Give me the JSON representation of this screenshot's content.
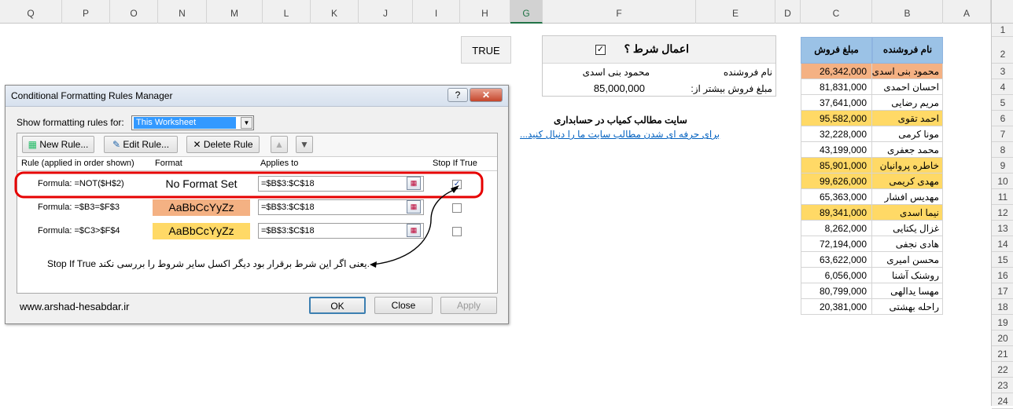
{
  "column_headers": [
    "Q",
    "P",
    "O",
    "N",
    "M",
    "L",
    "K",
    "J",
    "I",
    "H",
    "G",
    "F",
    "E",
    "D",
    "C",
    "B",
    "A"
  ],
  "selected_column": "G",
  "row_headers": [
    "1",
    "2",
    "3",
    "4",
    "5",
    "6",
    "7",
    "8",
    "9",
    "10",
    "11",
    "12",
    "13",
    "14",
    "15",
    "16",
    "17",
    "18",
    "19",
    "20",
    "21",
    "22",
    "23",
    "24"
  ],
  "true_cell": "TRUE",
  "condition_panel": {
    "title": "اعمال شرط ؟",
    "checkbox_checked": true,
    "row1_label": "نام فروشنده",
    "row1_value": "محمود بنی اسدی",
    "row2_label": "مبلغ فروش بیشتر از:",
    "row2_value": "85,000,000"
  },
  "site_note": {
    "title": "سایت مطالب کمیاب در حسابداری",
    "link": "برای حرفه ای شدن مطالب سایت ما را دنبال کنید..."
  },
  "table": {
    "header_seller": "نام فروشنده",
    "header_amount": "مبلغ فروش",
    "colors": {
      "header": "#9bc2e6",
      "row_match": "#f4b183",
      "amount_match": "#ffd966"
    },
    "rows": [
      {
        "name": "محمود بنی اسدی",
        "amount": "26,342,000",
        "highlight": "salmon"
      },
      {
        "name": "احسان احمدی",
        "amount": "81,831,000",
        "highlight": "none"
      },
      {
        "name": "مریم رضایی",
        "amount": "37,641,000",
        "highlight": "none"
      },
      {
        "name": "احمد تقوی",
        "amount": "95,582,000",
        "highlight": "yellow"
      },
      {
        "name": "مونا کرمی",
        "amount": "32,228,000",
        "highlight": "none"
      },
      {
        "name": "محمد جعفری",
        "amount": "43,199,000",
        "highlight": "none"
      },
      {
        "name": "خاطره پروانیان",
        "amount": "85,901,000",
        "highlight": "yellow"
      },
      {
        "name": "مهدی کریمی",
        "amount": "99,626,000",
        "highlight": "yellow"
      },
      {
        "name": "مهدیس افشار",
        "amount": "65,363,000",
        "highlight": "none"
      },
      {
        "name": "نیما اسدی",
        "amount": "89,341,000",
        "highlight": "yellow"
      },
      {
        "name": "غزال یکتایی",
        "amount": "8,262,000",
        "highlight": "none"
      },
      {
        "name": "هادی نجفی",
        "amount": "72,194,000",
        "highlight": "none"
      },
      {
        "name": "محسن امیری",
        "amount": "63,622,000",
        "highlight": "none"
      },
      {
        "name": "روشنک آشنا",
        "amount": "6,056,000",
        "highlight": "none"
      },
      {
        "name": "مهسا یدالهی",
        "amount": "80,799,000",
        "highlight": "none"
      },
      {
        "name": "راحله بهشتی",
        "amount": "20,381,000",
        "highlight": "none"
      }
    ]
  },
  "dialog": {
    "title": "Conditional Formatting Rules Manager",
    "help_label": "?",
    "show_label": "Show formatting rules for:",
    "show_value": "This Worksheet",
    "new_rule": "New Rule...",
    "edit_rule": "Edit Rule...",
    "delete_rule": "Delete Rule",
    "col_rule": "Rule (applied in order shown)",
    "col_format": "Format",
    "col_applies": "Applies to",
    "col_stop": "Stop If True",
    "rules": [
      {
        "formula": "Formula: =NOT($H$2)",
        "format": "No Format Set",
        "format_bg": "#ffffff",
        "applies": "=$B$3:$C$18",
        "stop": true
      },
      {
        "formula": "Formula: =$B3=$F$3",
        "format": "AaBbCcYyZz",
        "format_bg": "#f4b183",
        "applies": "=$B$3:$C$18",
        "stop": false
      },
      {
        "formula": "Formula: =$C3>$F$4",
        "format": "AaBbCcYyZz",
        "format_bg": "#ffd966",
        "applies": "=$B$3:$C$18",
        "stop": false
      }
    ],
    "annotation": "Stop If True یعنی اگر این شرط برقرار بود دیگر اکسل سایر شروط را بررسی نکند.",
    "watermark": "www.arshad-hesabdar.ir",
    "ok": "OK",
    "close": "Close",
    "apply": "Apply"
  }
}
